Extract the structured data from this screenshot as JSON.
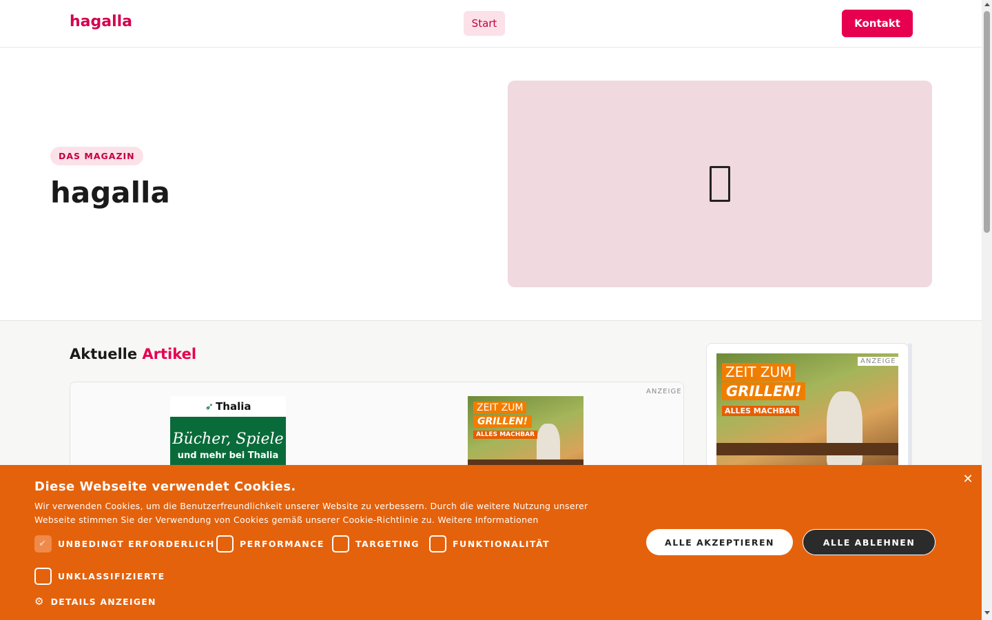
{
  "header": {
    "logo": "hagalla",
    "nav_start": "Start",
    "contact_button": "Kontakt"
  },
  "hero": {
    "badge": "DAS MAGAZIN",
    "title": "hagalla"
  },
  "section": {
    "title_main": "Aktuelle",
    "title_accent": "Artikel",
    "ad_label": "ANZEIGE",
    "thalia": {
      "brand": "Thalia",
      "line1": "Bücher, Spiele",
      "line2": "und mehr bei Thalia"
    },
    "grill": {
      "line1": "ZEIT ZUM",
      "line2": "GRILLEN!",
      "tag": "ALLES MACHBAR"
    }
  },
  "cookie": {
    "title": "Diese Webseite verwendet Cookies.",
    "text": "Wir verwenden Cookies, um die Benutzerfreundlichkeit unserer Website zu verbessern. Durch die weitere Nutzung unserer Webseite stimmen Sie der Verwendung von Cookies gemäß unserer Cookie-Richtlinie zu. Weitere Informationen",
    "options": [
      {
        "label": "UNBEDINGT ERFORDERLICH",
        "checked": true
      },
      {
        "label": "PERFORMANCE",
        "checked": false
      },
      {
        "label": "TARGETING",
        "checked": false
      },
      {
        "label": "FUNKTIONALITÄT",
        "checked": false
      },
      {
        "label": "UNKLASSIFIZIERTE",
        "checked": false
      }
    ],
    "accept_all": "ALLE AKZEPTIEREN",
    "reject_all": "ALLE ABLEHNEN",
    "details": "DETAILS ANZEIGEN"
  },
  "colors": {
    "brand": "#e6004f",
    "cookie_bg": "#e4620c",
    "hero_image_bg": "#f0d9df"
  }
}
